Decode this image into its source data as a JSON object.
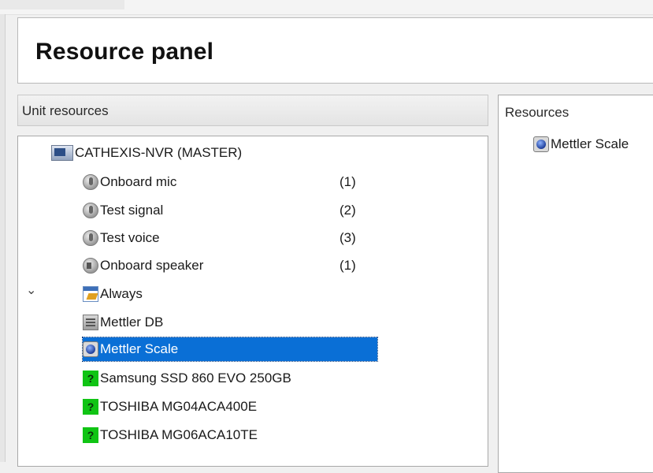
{
  "header": {
    "title": "Resource panel"
  },
  "left_panel": {
    "label": "Unit resources",
    "root": {
      "label": "CATHEXIS-NVR (MASTER)",
      "icon": "server-icon",
      "expanded": true
    },
    "items": [
      {
        "label": "Onboard mic",
        "count": "(1)",
        "icon": "microphone-icon"
      },
      {
        "label": "Test signal",
        "count": "(2)",
        "icon": "microphone-icon"
      },
      {
        "label": "Test voice",
        "count": "(3)",
        "icon": "microphone-icon"
      },
      {
        "label": "Onboard speaker",
        "count": "(1)",
        "icon": "speaker-icon"
      },
      {
        "label": "Always",
        "count": "",
        "icon": "calendar-icon"
      },
      {
        "label": "Mettler DB",
        "count": "",
        "icon": "database-icon"
      },
      {
        "label": "Mettler Scale",
        "count": "",
        "icon": "scale-icon",
        "selected": true
      },
      {
        "label": "Samsung SSD 860 EVO 250GB",
        "count": "",
        "icon": "unknown-device-icon"
      },
      {
        "label": "TOSHIBA MG04ACA400E",
        "count": "",
        "icon": "unknown-device-icon"
      },
      {
        "label": "TOSHIBA MG06ACA10TE",
        "count": "",
        "icon": "unknown-device-icon"
      }
    ]
  },
  "right_panel": {
    "label": "Resources",
    "items": [
      {
        "label": "Mettler Scale",
        "icon": "scale-icon"
      }
    ]
  },
  "colors": {
    "selection": "#0a6fd6",
    "unknown_icon": "#10c414"
  }
}
